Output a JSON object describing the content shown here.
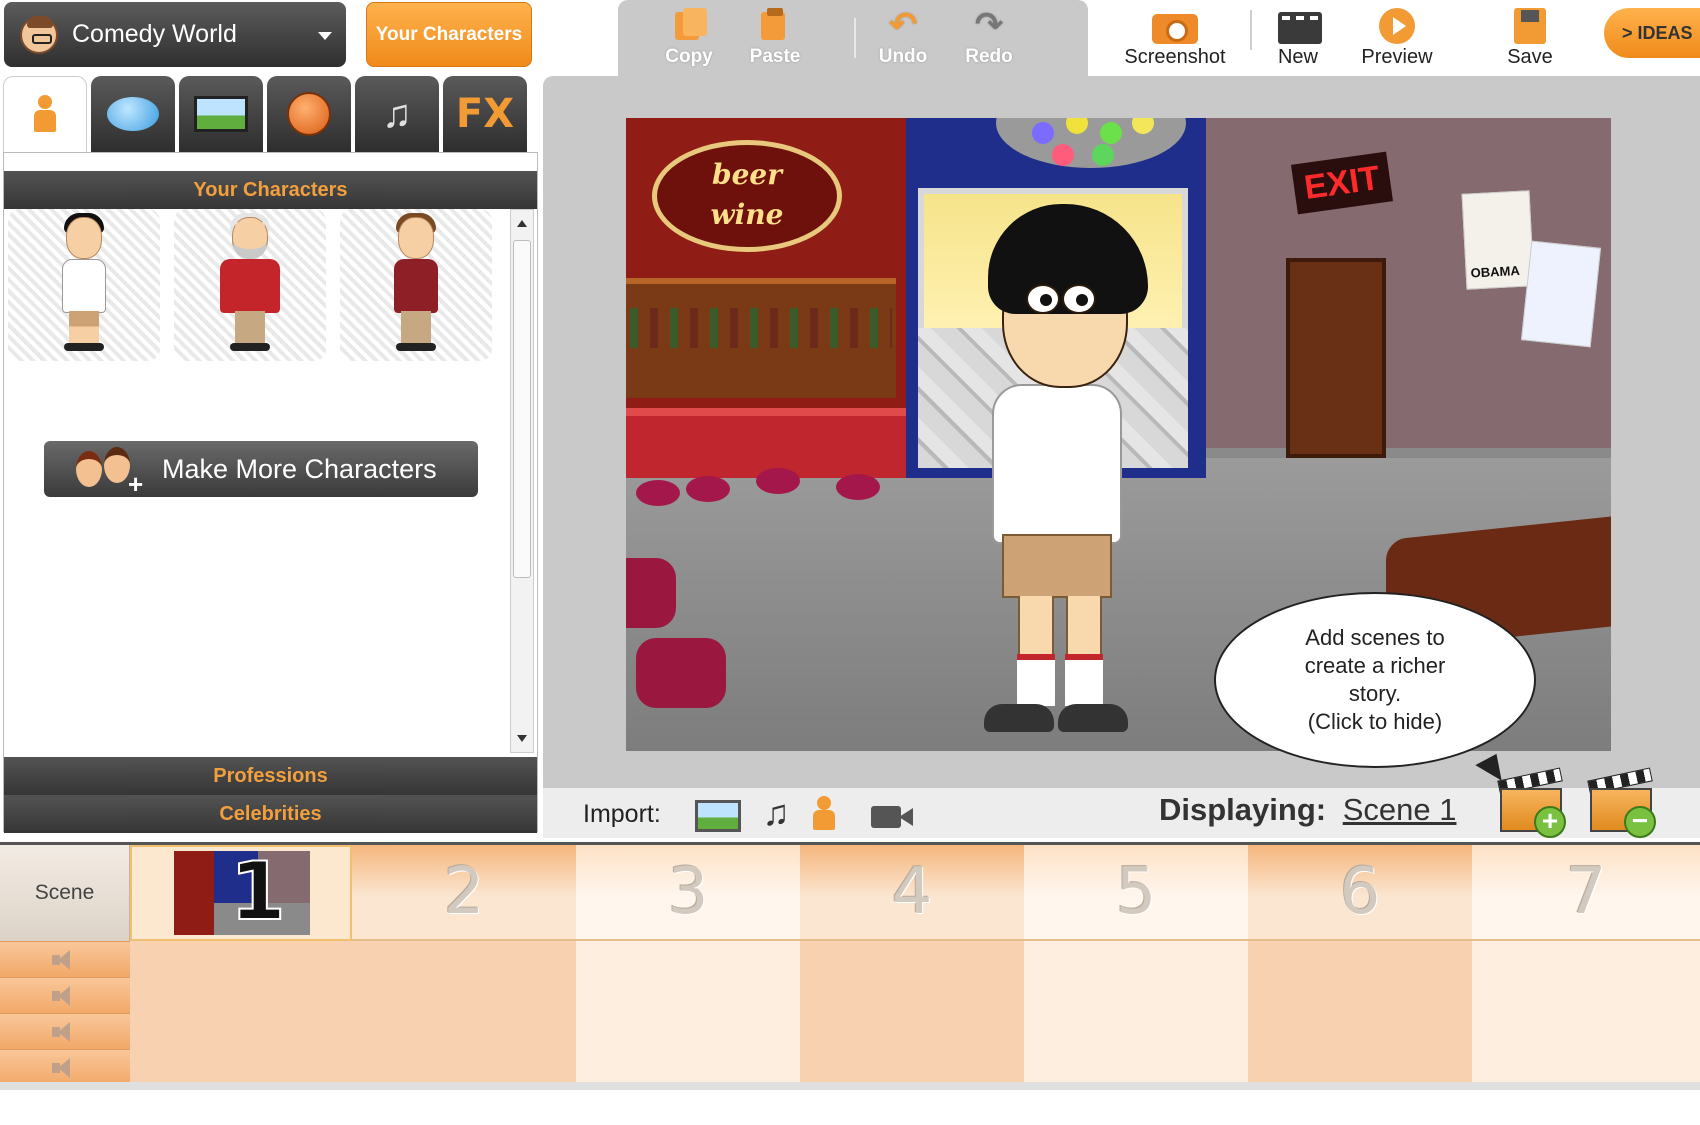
{
  "theme_select": {
    "label": "Comedy World",
    "icon": "caveman-face-icon"
  },
  "header": {
    "your_characters_label": "Your Characters",
    "ideas_label": "> IDEAS"
  },
  "edit_toolbar": {
    "copy": "Copy",
    "paste": "Paste",
    "undo": "Undo",
    "redo": "Redo"
  },
  "main_toolbar": {
    "screenshot": "Screenshot",
    "new": "New",
    "preview": "Preview",
    "save": "Save"
  },
  "asset_tabs": [
    {
      "name": "characters",
      "icon": "person-icon",
      "active": true
    },
    {
      "name": "dialog",
      "icon": "speech-bubble-icon",
      "active": false
    },
    {
      "name": "backgrounds",
      "icon": "landscape-icon",
      "active": false
    },
    {
      "name": "props",
      "icon": "basketball-icon",
      "active": false
    },
    {
      "name": "music",
      "icon": "music-note-icon",
      "active": false
    },
    {
      "name": "effects",
      "label": "FX",
      "active": false
    }
  ],
  "asset_panel": {
    "section_your_characters": "Your Characters",
    "section_professions": "Professions",
    "section_celebrities": "Celebrities",
    "make_more_label": "Make More Characters"
  },
  "stage": {
    "bar_sign": "beer\nwine",
    "exit_sign": "EXIT",
    "poster_text": "OBAMA"
  },
  "tip": {
    "line1": "Add scenes to",
    "line2": "create a richer",
    "line3": "story.",
    "line4": "(Click to hide)"
  },
  "import_bar": {
    "label": "Import:",
    "displaying_label": "Displaying:",
    "displaying_value": "Scene 1"
  },
  "timeline": {
    "scene_header": "Scene",
    "slots": [
      "1",
      "2",
      "3",
      "4",
      "5",
      "6",
      "7"
    ]
  },
  "colors": {
    "accent": "#f29a33",
    "panel_dark": "#3a3a3a",
    "stage_frame": "#c9c9c9"
  }
}
